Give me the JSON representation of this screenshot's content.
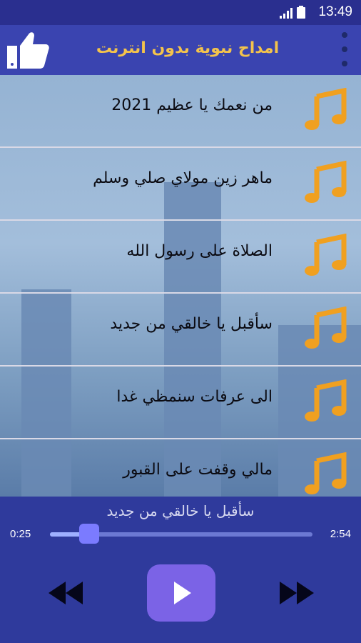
{
  "status": {
    "time": "13:49"
  },
  "appbar": {
    "title": "امداح نبوية بدون انترنت"
  },
  "songs": [
    {
      "title": "من نعمك يا عظيم 2021"
    },
    {
      "title": "ماهر زين مولاي  صلي وسلم"
    },
    {
      "title": "الصلاة على رسول الله"
    },
    {
      "title": "سأقبل يا خالقي من جديد"
    },
    {
      "title": "الى عرفات سنمظي غدا"
    },
    {
      "title": "مالي وقفت على القبور"
    }
  ],
  "player": {
    "now_playing": "سأقبل يا خالقي من جديد",
    "current_time": "0:25",
    "total_time": "2:54",
    "progress": 0.15
  },
  "colors": {
    "accent": "#f3c34c",
    "note": "#f0a020",
    "bar": "#2f3a9c"
  },
  "icons": [
    "signal-icon",
    "battery-icon",
    "like-icon",
    "overflow-menu-icon",
    "music-note-icon",
    "rewind-icon",
    "play-icon",
    "fast-forward-icon"
  ]
}
